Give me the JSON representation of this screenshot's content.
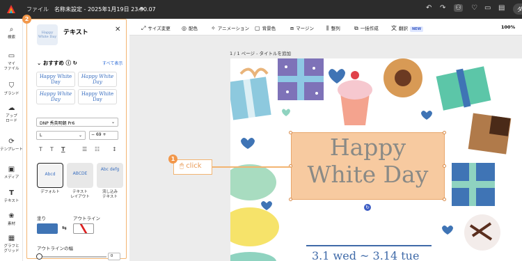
{
  "topbar": {
    "file_menu": "ファイル",
    "doc_title": "名称未設定 - 2025年1月19日 23.50.07",
    "share_label": "ダ"
  },
  "rail": [
    {
      "label": "検索",
      "icon": "search-icon"
    },
    {
      "label": "マイ\nファイル",
      "icon": "folder-icon"
    },
    {
      "label": "ブランド",
      "icon": "brand-icon"
    },
    {
      "label": "アップ\nロード",
      "icon": "upload-icon"
    },
    {
      "label": "テンプレート",
      "icon": "template-icon"
    },
    {
      "label": "メディア",
      "icon": "media-icon"
    },
    {
      "label": "テキスト",
      "icon": "text-icon"
    },
    {
      "label": "素材",
      "icon": "elements-icon"
    },
    {
      "label": "グラフと\nグリッド",
      "icon": "chart-icon"
    }
  ],
  "panel": {
    "title": "テキスト",
    "thumb_text": "Happy White Day",
    "recommended": "おすすめ",
    "see_all": "すべて表示",
    "cards": [
      "Happy White Day",
      "Happy White Day",
      "Happy White Day",
      "Happy White Day"
    ],
    "font_name": "DNP 秀英明朝 Pr6",
    "font_weight": "L",
    "font_size": "69",
    "styles": [
      {
        "label": "デフォルト",
        "sample": "Abcd"
      },
      {
        "label": "テキスト\nレイアウト",
        "sample": "ABCDE"
      },
      {
        "label": "流し込み\nテキスト",
        "sample": "Abc defg"
      }
    ],
    "fill_label": "塗り",
    "outline_label": "アウトライン",
    "outline_width_label": "アウトラインの幅",
    "outline_width_value": "0",
    "fill_color": "#3f74b5"
  },
  "toolbar": {
    "items": [
      "サイズ変更",
      "配色",
      "アニメーション",
      "背景色",
      "マージン",
      "整列",
      "一括作成",
      "翻訳"
    ],
    "new_badge": "NEW",
    "zoom": "100%"
  },
  "canvas": {
    "page_label": "1 / 1 ページ - タイトルを追加",
    "headline_line1": "Happy",
    "headline_line2": "White Day",
    "date_text": "3.1 wed ~ 3.14 tue"
  },
  "annotations": {
    "step1": "1",
    "step2": "2",
    "click_label": "click"
  },
  "colors": {
    "accent_orange": "#f2974a",
    "selection_fill": "#f7c698",
    "headline_color": "#8a8a86"
  }
}
